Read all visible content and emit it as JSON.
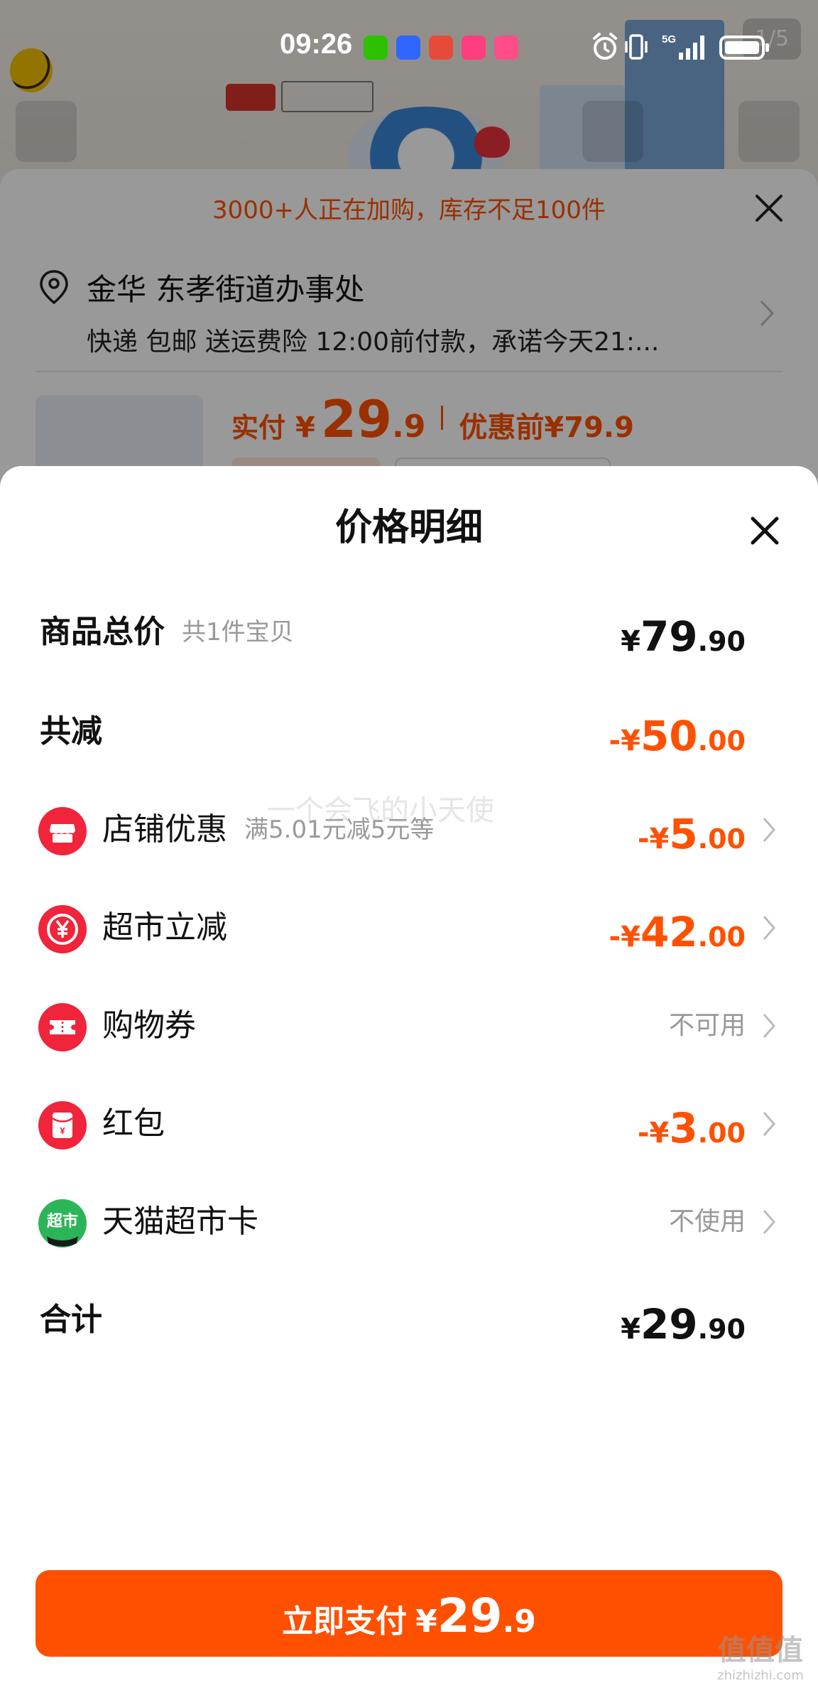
{
  "status_bar": {
    "time": "09:26",
    "network": "5G"
  },
  "background_page": {
    "image_counter": "1/5",
    "banner": "3000+人正在加购，库存不足100件",
    "address": {
      "title": "金华 东孝街道办事处",
      "detail": "快递 包邮 送运费险 12:00前付款，承诺今天21:..."
    },
    "price": {
      "paid_label": "实付",
      "currency": "¥",
      "paid_int": "29",
      "paid_dec": ".9",
      "before_label": "优惠前",
      "before_value": "¥79.9"
    }
  },
  "sheet": {
    "title": "价格明细",
    "rows": {
      "total_goods": {
        "label": "商品总价",
        "hint": "共1件宝贝",
        "sym": "¥",
        "int": "79",
        "dec": ".90"
      },
      "total_reduction": {
        "label": "共减",
        "sym": "-¥",
        "int": "50",
        "dec": ".00"
      },
      "store_discount": {
        "label": "店铺优惠",
        "hint": "满5.01元减5元等",
        "sym": "-¥",
        "int": "5",
        "dec": ".00",
        "icon": "store-icon"
      },
      "supermarket_reduction": {
        "label": "超市立减",
        "sym": "-¥",
        "int": "42",
        "dec": ".00",
        "icon": "yen-coin-icon"
      },
      "shopping_coupon": {
        "label": "购物券",
        "status": "不可用",
        "icon": "ticket-icon"
      },
      "red_packet": {
        "label": "红包",
        "sym": "-¥",
        "int": "3",
        "dec": ".00",
        "icon": "red-packet-icon"
      },
      "tmall_card": {
        "label": "天猫超市卡",
        "status": "不使用",
        "icon": "supermarket-card-icon",
        "icon_text": "超市"
      },
      "grand_total": {
        "label": "合计",
        "sym": "¥",
        "int": "29",
        "dec": ".90"
      }
    }
  },
  "pay_button": {
    "label": "立即支付",
    "currency": "¥",
    "int": "29",
    "dec": ".9"
  },
  "watermark": {
    "text": "一个会飞的小天使",
    "logo": "值值值",
    "site": "zhizhizhi.com"
  },
  "colors": {
    "accent": "#ff5000",
    "text_primary": "#111111",
    "text_secondary": "#999999",
    "icon_red": "#f0243a",
    "icon_green": "#2cb558"
  }
}
